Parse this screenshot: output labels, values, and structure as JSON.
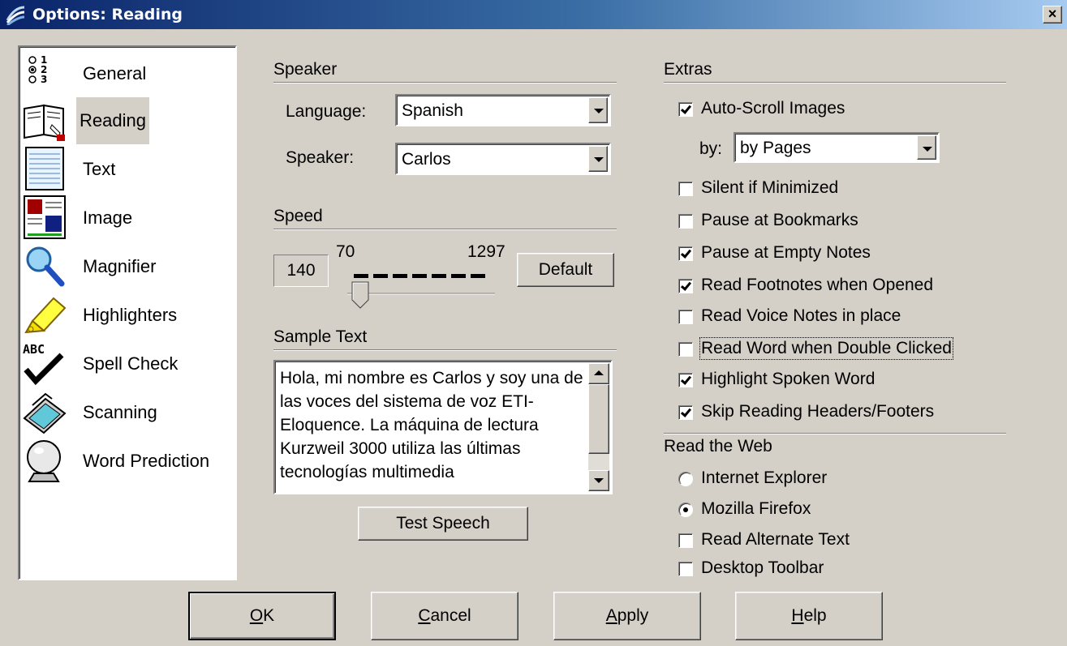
{
  "window": {
    "title": "Options: Reading",
    "close_label": "×"
  },
  "sidebar": {
    "selected": "Reading",
    "items": [
      {
        "label": "General",
        "icon": "radio-list-icon"
      },
      {
        "label": "Reading",
        "icon": "book-icon"
      },
      {
        "label": "Text",
        "icon": "text-page-icon"
      },
      {
        "label": "Image",
        "icon": "image-icon"
      },
      {
        "label": "Magnifier",
        "icon": "magnifier-icon"
      },
      {
        "label": "Highlighters",
        "icon": "highlighter-icon"
      },
      {
        "label": "Spell Check",
        "icon": "spell-check-icon"
      },
      {
        "label": "Scanning",
        "icon": "scanner-icon"
      },
      {
        "label": "Word Prediction",
        "icon": "crystal-ball-icon"
      }
    ]
  },
  "speaker": {
    "header": "Speaker",
    "language_label": "Language:",
    "language_value": "Spanish",
    "speaker_label": "Speaker:",
    "speaker_value": "Carlos"
  },
  "speed": {
    "header": "Speed",
    "value": "140",
    "min": "70",
    "max": "1297",
    "default_label": "Default"
  },
  "sample": {
    "header": "Sample Text",
    "text": "Hola, mi nombre es Carlos y soy una de las voces del sistema de voz ETI-Eloquence. La máquina de lectura Kurzweil 3000 utiliza las últimas tecnologías multimedia",
    "test_label": "Test Speech"
  },
  "extras": {
    "header": "Extras",
    "auto_scroll": {
      "label": "Auto-Scroll Images",
      "checked": true
    },
    "by_label": "by:",
    "by_value": "by Pages",
    "options": [
      {
        "label": "Silent if Minimized",
        "checked": false
      },
      {
        "label": "Pause at Bookmarks",
        "checked": false
      },
      {
        "label": "Pause at Empty Notes",
        "checked": true
      },
      {
        "label": "Read Footnotes when Opened",
        "checked": true
      },
      {
        "label": "Read Voice Notes in place",
        "checked": false
      },
      {
        "label": "Read Word when Double Clicked",
        "checked": false
      },
      {
        "label": "Highlight Spoken Word",
        "checked": true
      },
      {
        "label": "Skip Reading Headers/Footers",
        "checked": true
      }
    ]
  },
  "web": {
    "header": "Read the Web",
    "radios": [
      {
        "label": "Internet Explorer",
        "checked": false
      },
      {
        "label": "Mozilla Firefox",
        "checked": true
      }
    ],
    "options": [
      {
        "label": "Read Alternate Text",
        "checked": false
      },
      {
        "label": "Desktop Toolbar",
        "checked": false
      }
    ]
  },
  "buttons": {
    "ok_mn": "O",
    "ok_rest": "K",
    "cancel_mn": "C",
    "cancel_rest": "ancel",
    "apply_mn": "A",
    "apply_rest": "pply",
    "help_mn": "H",
    "help_rest": "elp"
  }
}
